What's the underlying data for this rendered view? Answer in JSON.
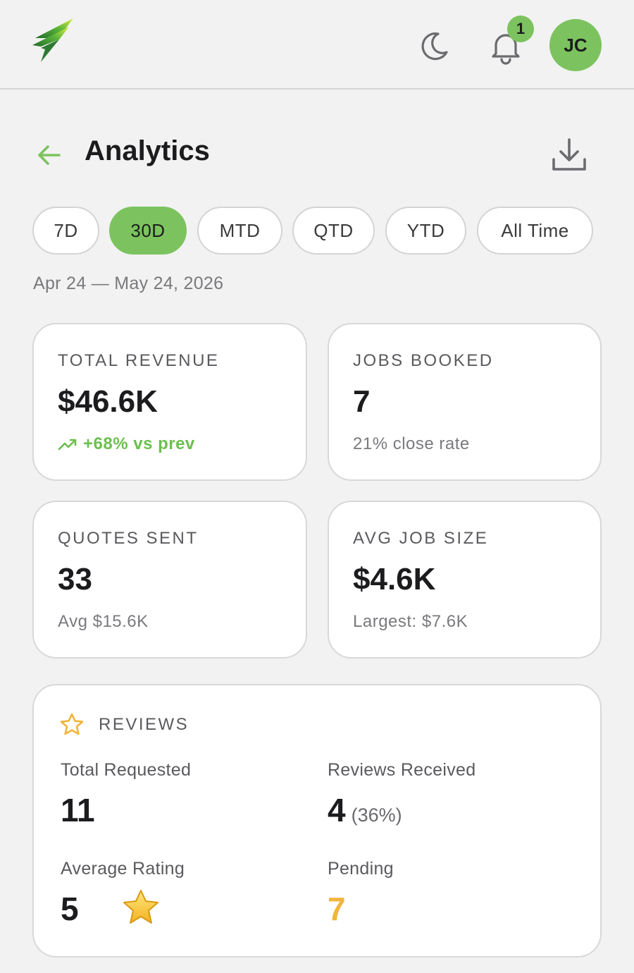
{
  "header": {
    "notification_count": "1",
    "avatar_initials": "JC",
    "brand_color": "#7cc35f"
  },
  "page": {
    "title": "Analytics",
    "date_range": "Apr 24 — May 24, 2026"
  },
  "filters": [
    {
      "label": "7D",
      "active": false
    },
    {
      "label": "30D",
      "active": true
    },
    {
      "label": "MTD",
      "active": false
    },
    {
      "label": "QTD",
      "active": false
    },
    {
      "label": "YTD",
      "active": false
    },
    {
      "label": "All Time",
      "active": false
    }
  ],
  "stats": {
    "revenue": {
      "label": "TOTAL REVENUE",
      "value": "$46.6K",
      "sub": "+68% vs prev"
    },
    "jobs": {
      "label": "JOBS BOOKED",
      "value": "7",
      "sub": "21% close rate"
    },
    "quotes": {
      "label": "QUOTES SENT",
      "value": "33",
      "sub": "Avg $15.6K"
    },
    "avg_job": {
      "label": "AVG JOB SIZE",
      "value": "$4.6K",
      "sub": "Largest: $7.6K"
    }
  },
  "reviews": {
    "title": "REVIEWS",
    "total_requested_label": "Total Requested",
    "total_requested": "11",
    "received_label": "Reviews Received",
    "received": "4",
    "received_pct": "(36%)",
    "rating_label": "Average Rating",
    "rating": "5",
    "pending_label": "Pending",
    "pending": "7"
  },
  "icons": {
    "logo": "bolt-logo-icon",
    "theme": "moon-icon",
    "notifications": "bell-icon",
    "back": "arrow-left-icon",
    "export": "download-icon",
    "trend": "trending-up-icon",
    "reviews": "star-outline-icon",
    "rating": "star-filled-icon"
  }
}
